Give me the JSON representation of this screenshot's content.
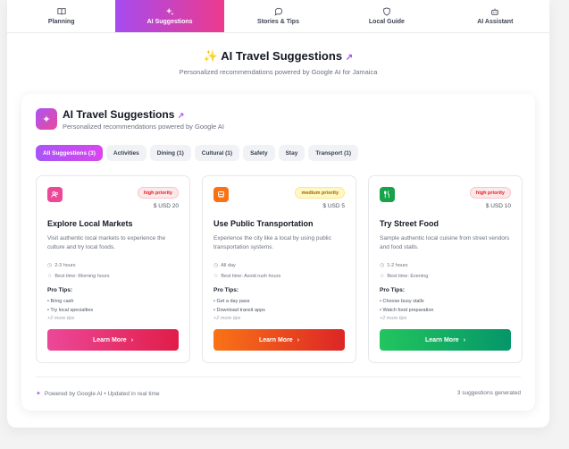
{
  "tabs": [
    {
      "label": "Planning",
      "icon": "book-icon",
      "active": false
    },
    {
      "label": "AI Suggestions",
      "icon": "sparkles-icon",
      "active": true
    },
    {
      "label": "Stories & Tips",
      "icon": "chat-bubble-icon",
      "active": false
    },
    {
      "label": "Local Guide",
      "icon": "shield-icon",
      "active": false
    },
    {
      "label": "AI Assistant",
      "icon": "robot-icon",
      "active": false
    }
  ],
  "hero": {
    "title": "AI Travel Suggestions",
    "subtitle": "Personalized recommendations powered by Google AI for Jamaica"
  },
  "panel": {
    "title": "AI Travel Suggestions",
    "subtitle": "Personalized recommendations powered by Google AI"
  },
  "filters": [
    "All Suggestions (3)",
    "Activities",
    "Dining (1)",
    "Cultural (1)",
    "Safety",
    "Stay",
    "Transport (1)"
  ],
  "cards": [
    {
      "icon": "people-icon",
      "icon_color": "#ec4899",
      "priority": "high priority",
      "priority_bg": "#fde8ea",
      "priority_fg": "#dc2626",
      "priority_border": "#f9c4c9",
      "price": "$ USD 20",
      "title": "Explore Local Markets",
      "description": "Visit authentic local markets to experience the culture and try local foods.",
      "duration": "2-3 hours",
      "best_time": "Best time: Morning hours",
      "tips_heading": "Pro Tips:",
      "tips": [
        "Bring cash",
        "Try local specialties"
      ],
      "more_tips": "+2 more tips",
      "button": "Learn More",
      "button_from": "#ec4899",
      "button_to": "#e11d48"
    },
    {
      "icon": "bus-icon",
      "icon_color": "#f97316",
      "priority": "medium priority",
      "priority_bg": "#fef9c3",
      "priority_fg": "#a16207",
      "priority_border": "#fde68a",
      "price": "$ USD 5",
      "title": "Use Public Transportation",
      "description": "Experience the city like a local by using public transportation systems.",
      "duration": "All day",
      "best_time": "Best time: Avoid rush hours",
      "tips_heading": "Pro Tips:",
      "tips": [
        "Get a day pass",
        "Download transit apps"
      ],
      "more_tips": "+2 more tips",
      "button": "Learn More",
      "button_from": "#f97316",
      "button_to": "#dc2626"
    },
    {
      "icon": "utensils-icon",
      "icon_color": "#16a34a",
      "priority": "high priority",
      "priority_bg": "#fde8ea",
      "priority_fg": "#dc2626",
      "priority_border": "#f9c4c9",
      "price": "$ USD 10",
      "title": "Try Street Food",
      "description": "Sample authentic local cuisine from street vendors and food stalls.",
      "duration": "1-2 hours",
      "best_time": "Best time: Evening",
      "tips_heading": "Pro Tips:",
      "tips": [
        "Choose busy stalls",
        "Watch food preparation"
      ],
      "more_tips": "+2 more tips",
      "button": "Learn More",
      "button_from": "#22c55e",
      "button_to": "#059669"
    }
  ],
  "footer": {
    "left": "Powered by Google AI • Updated in real time",
    "right": "3 suggestions generated"
  }
}
